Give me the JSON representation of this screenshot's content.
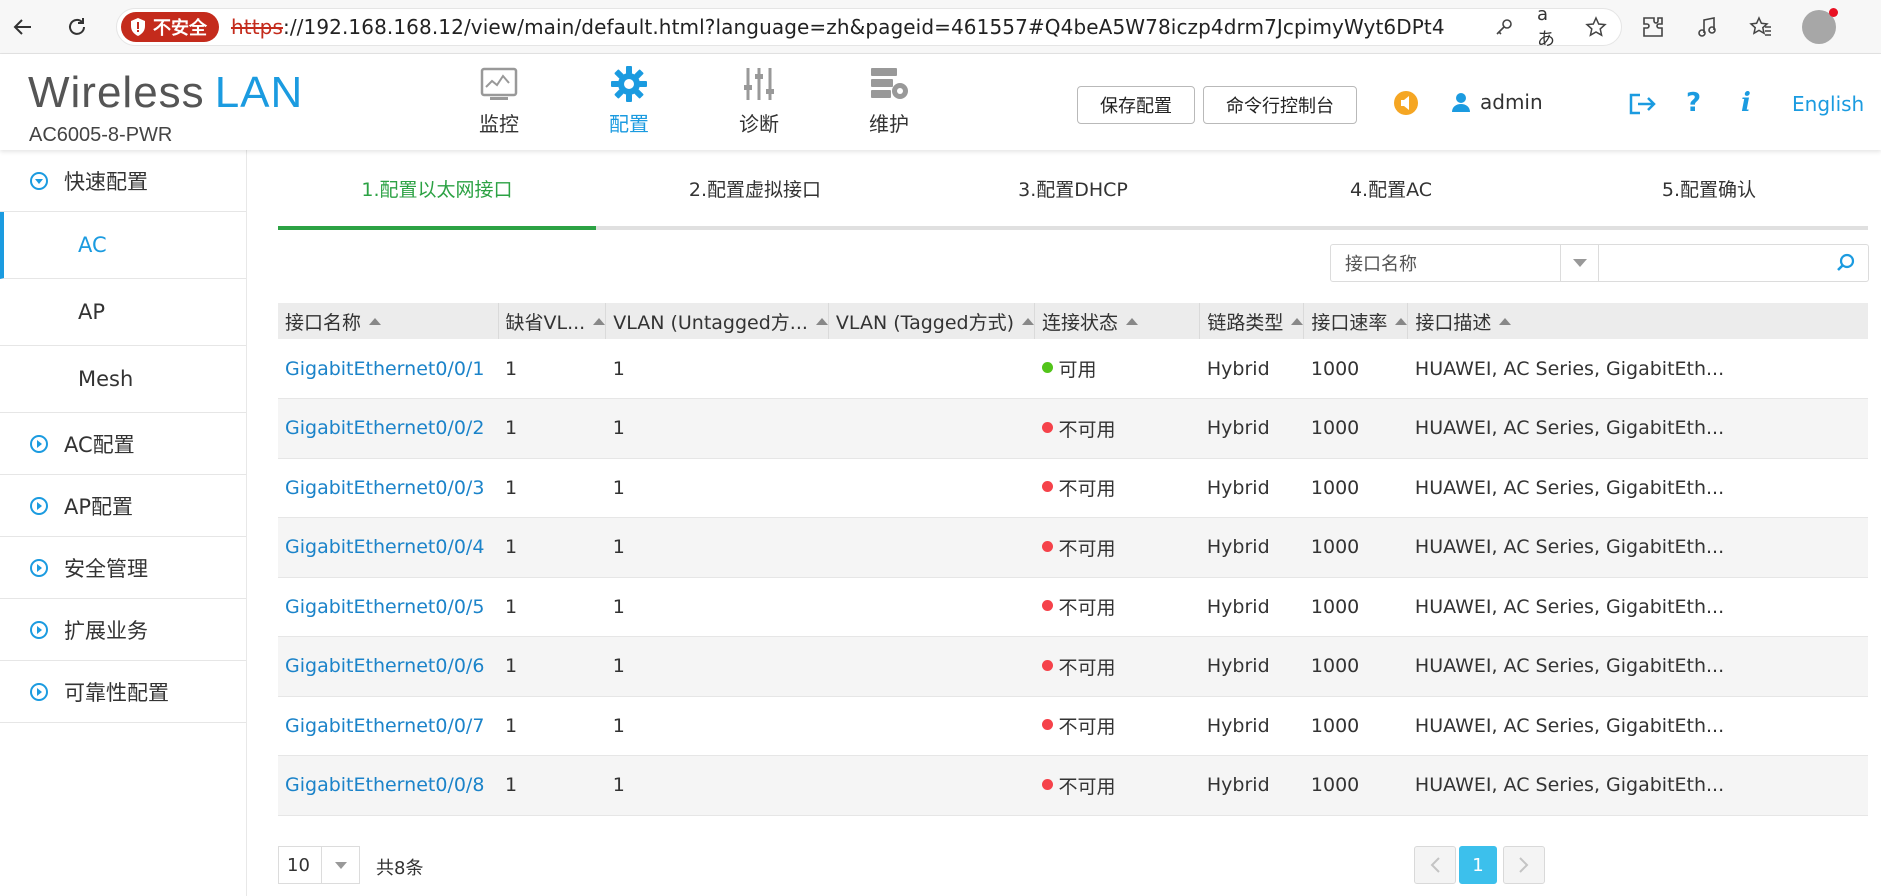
{
  "browser": {
    "insecure_label": "不安全",
    "url_scheme": "https",
    "url_rest": "://192.168.168.12/view/main/default.html?language=zh&pageid=461557#Q4beA5W78iczp4drm7JcpimyWyt6DPt4"
  },
  "header": {
    "brand_word": "Wireless",
    "brand_accent": "LAN",
    "model": "AC6005-8-PWR",
    "nav": [
      {
        "label": "监控",
        "icon": "monitor-icon"
      },
      {
        "label": "配置",
        "icon": "gear-icon"
      },
      {
        "label": "诊断",
        "icon": "sliders-icon"
      },
      {
        "label": "维护",
        "icon": "server-gear-icon"
      }
    ],
    "save_config": "保存配置",
    "cli_console": "命令行控制台",
    "username": "admin",
    "language": "English"
  },
  "sidebar": {
    "quick_config": "快速配置",
    "quick_items": [
      "AC",
      "AP",
      "Mesh"
    ],
    "groups": [
      "AC配置",
      "AP配置",
      "安全管理",
      "扩展业务",
      "可靠性配置"
    ]
  },
  "steps": [
    "1.配置以太网接口",
    "2.配置虚拟接口",
    "3.配置DHCP",
    "4.配置AC",
    "5.配置确认"
  ],
  "search": {
    "field": "接口名称",
    "value": ""
  },
  "table": {
    "columns": [
      "接口名称",
      "缺省VL...",
      "VLAN (Untagged方...",
      "VLAN (Tagged方式)",
      "连接状态",
      "链路类型",
      "接口速率",
      "接口描述"
    ],
    "rows": [
      {
        "name": "GigabitEthernet0/0/1",
        "pvid": "1",
        "untagged": "1",
        "tagged": "",
        "status": "可用",
        "status_color": "#52c41a",
        "type": "Hybrid",
        "speed": "1000",
        "desc": "HUAWEI, AC Series, GigabitEth..."
      },
      {
        "name": "GigabitEthernet0/0/2",
        "pvid": "1",
        "untagged": "1",
        "tagged": "",
        "status": "不可用",
        "status_color": "#f5424a",
        "type": "Hybrid",
        "speed": "1000",
        "desc": "HUAWEI, AC Series, GigabitEth..."
      },
      {
        "name": "GigabitEthernet0/0/3",
        "pvid": "1",
        "untagged": "1",
        "tagged": "",
        "status": "不可用",
        "status_color": "#f5424a",
        "type": "Hybrid",
        "speed": "1000",
        "desc": "HUAWEI, AC Series, GigabitEth..."
      },
      {
        "name": "GigabitEthernet0/0/4",
        "pvid": "1",
        "untagged": "1",
        "tagged": "",
        "status": "不可用",
        "status_color": "#f5424a",
        "type": "Hybrid",
        "speed": "1000",
        "desc": "HUAWEI, AC Series, GigabitEth..."
      },
      {
        "name": "GigabitEthernet0/0/5",
        "pvid": "1",
        "untagged": "1",
        "tagged": "",
        "status": "不可用",
        "status_color": "#f5424a",
        "type": "Hybrid",
        "speed": "1000",
        "desc": "HUAWEI, AC Series, GigabitEth..."
      },
      {
        "name": "GigabitEthernet0/0/6",
        "pvid": "1",
        "untagged": "1",
        "tagged": "",
        "status": "不可用",
        "status_color": "#f5424a",
        "type": "Hybrid",
        "speed": "1000",
        "desc": "HUAWEI, AC Series, GigabitEth..."
      },
      {
        "name": "GigabitEthernet0/0/7",
        "pvid": "1",
        "untagged": "1",
        "tagged": "",
        "status": "不可用",
        "status_color": "#f5424a",
        "type": "Hybrid",
        "speed": "1000",
        "desc": "HUAWEI, AC Series, GigabitEth..."
      },
      {
        "name": "GigabitEthernet0/0/8",
        "pvid": "1",
        "untagged": "1",
        "tagged": "",
        "status": "不可用",
        "status_color": "#f5424a",
        "type": "Hybrid",
        "speed": "1000",
        "desc": "HUAWEI, AC Series, GigabitEth..."
      }
    ]
  },
  "pager": {
    "page_size": "10",
    "total": "共8条",
    "current_page": "1"
  },
  "colors": {
    "accent": "#1b9be0",
    "step_active": "#2ca244",
    "insecure": "#c42b1c"
  }
}
